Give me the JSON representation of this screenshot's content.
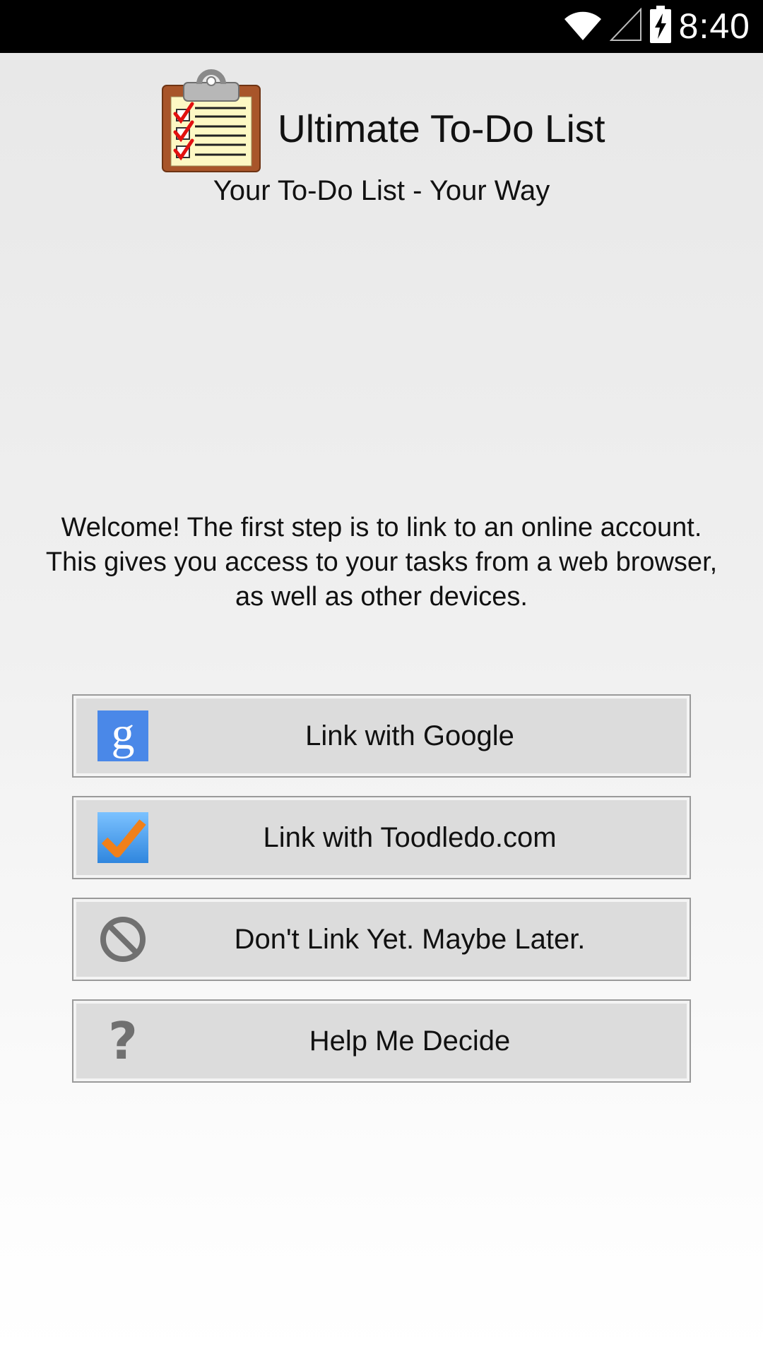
{
  "status_bar": {
    "time": "8:40",
    "icons": [
      "wifi-icon",
      "cell-signal-icon",
      "battery-charging-icon"
    ]
  },
  "app": {
    "title": "Ultimate To-Do List",
    "subtitle": "Your To-Do List - Your Way",
    "logo_icon": "clipboard-checklist-icon"
  },
  "welcome": {
    "lines": [
      "Welcome! The first step is to link to an online account.",
      "This gives you access to your tasks from a web browser,",
      "as well as other devices."
    ]
  },
  "buttons": [
    {
      "label": "Link with Google",
      "icon": "google-icon"
    },
    {
      "label": "Link with Toodledo.com",
      "icon": "toodledo-icon"
    },
    {
      "label": "Don't Link Yet. Maybe Later.",
      "icon": "no-symbol-icon"
    },
    {
      "label": "Help Me Decide",
      "icon": "question-mark-icon"
    }
  ],
  "colors": {
    "status_bar": "#000000",
    "button_face": "#dcdcdc",
    "button_border": "#9a9a9a",
    "google_blue": "#4a88e8",
    "toodledo_orange": "#f0801a",
    "toodledo_blue": "#4aa0f0",
    "clipboard_brown": "#a8552a",
    "check_red": "#e21010"
  }
}
